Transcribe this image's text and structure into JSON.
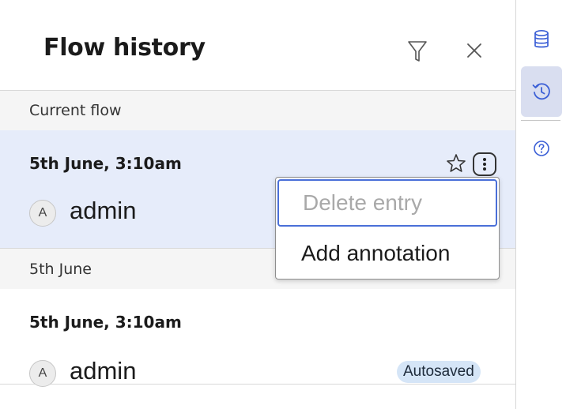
{
  "panel": {
    "title": "Flow history",
    "filter_icon": "filter-icon",
    "close_icon": "close-icon"
  },
  "sections": [
    {
      "label": "Current flow",
      "entries": [
        {
          "time": "5th June, 3:10am",
          "avatar_initial": "A",
          "user": "admin",
          "selected": true
        }
      ]
    },
    {
      "label": "5th June",
      "entries": [
        {
          "time": "5th June, 3:10am",
          "avatar_initial": "A",
          "user": "admin",
          "badge": "Autosaved"
        }
      ]
    }
  ],
  "context_menu": {
    "items": [
      {
        "label": "Delete entry",
        "disabled": true
      },
      {
        "label": "Add annotation",
        "disabled": false
      }
    ]
  },
  "rail": {
    "items": [
      "database-icon",
      "history-icon",
      "help-icon"
    ],
    "active": "history-icon"
  },
  "colors": {
    "selected_row": "#e6ecfa",
    "section_header": "#f5f5f5",
    "badge_bg": "#d5e5f7",
    "focus_ring": "#4a6fd8",
    "rail_icon": "#3b5fd6"
  }
}
